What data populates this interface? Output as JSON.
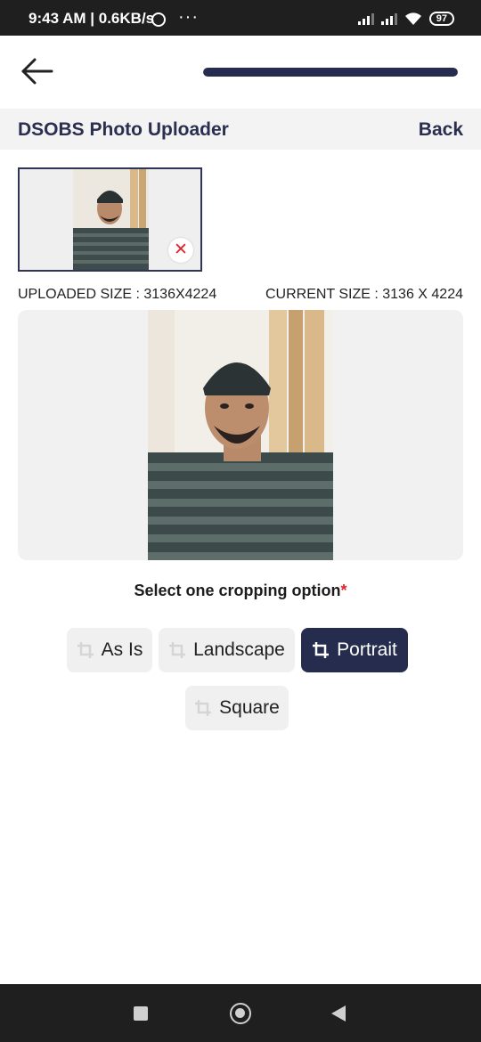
{
  "status_bar": {
    "time_speed": "9:43 AM | 0.6KB/s",
    "more": "···",
    "battery": "97"
  },
  "app_bar": {
    "progress": 1.0
  },
  "header": {
    "title": "DSOBS Photo Uploader",
    "back_label": "Back"
  },
  "thumbnail": {
    "remove_glyph": "✕"
  },
  "sizes": {
    "uploaded": "UPLOADED SIZE : 3136X4224",
    "current": "CURRENT SIZE : 3136 X 4224"
  },
  "cropping": {
    "prompt": "Select one cropping option",
    "required_marker": "*",
    "options": [
      {
        "label": "As Is",
        "icon": "crop-icon",
        "selected": false
      },
      {
        "label": "Landscape",
        "icon": "crop-icon",
        "selected": false
      },
      {
        "label": "Portrait",
        "icon": "crop-icon",
        "selected": true
      },
      {
        "label": "Square",
        "icon": "crop-icon",
        "selected": false
      }
    ]
  },
  "colors": {
    "primary": "#262c4d",
    "required": "#e2232b",
    "chip_bg": "#f0f0f0"
  }
}
